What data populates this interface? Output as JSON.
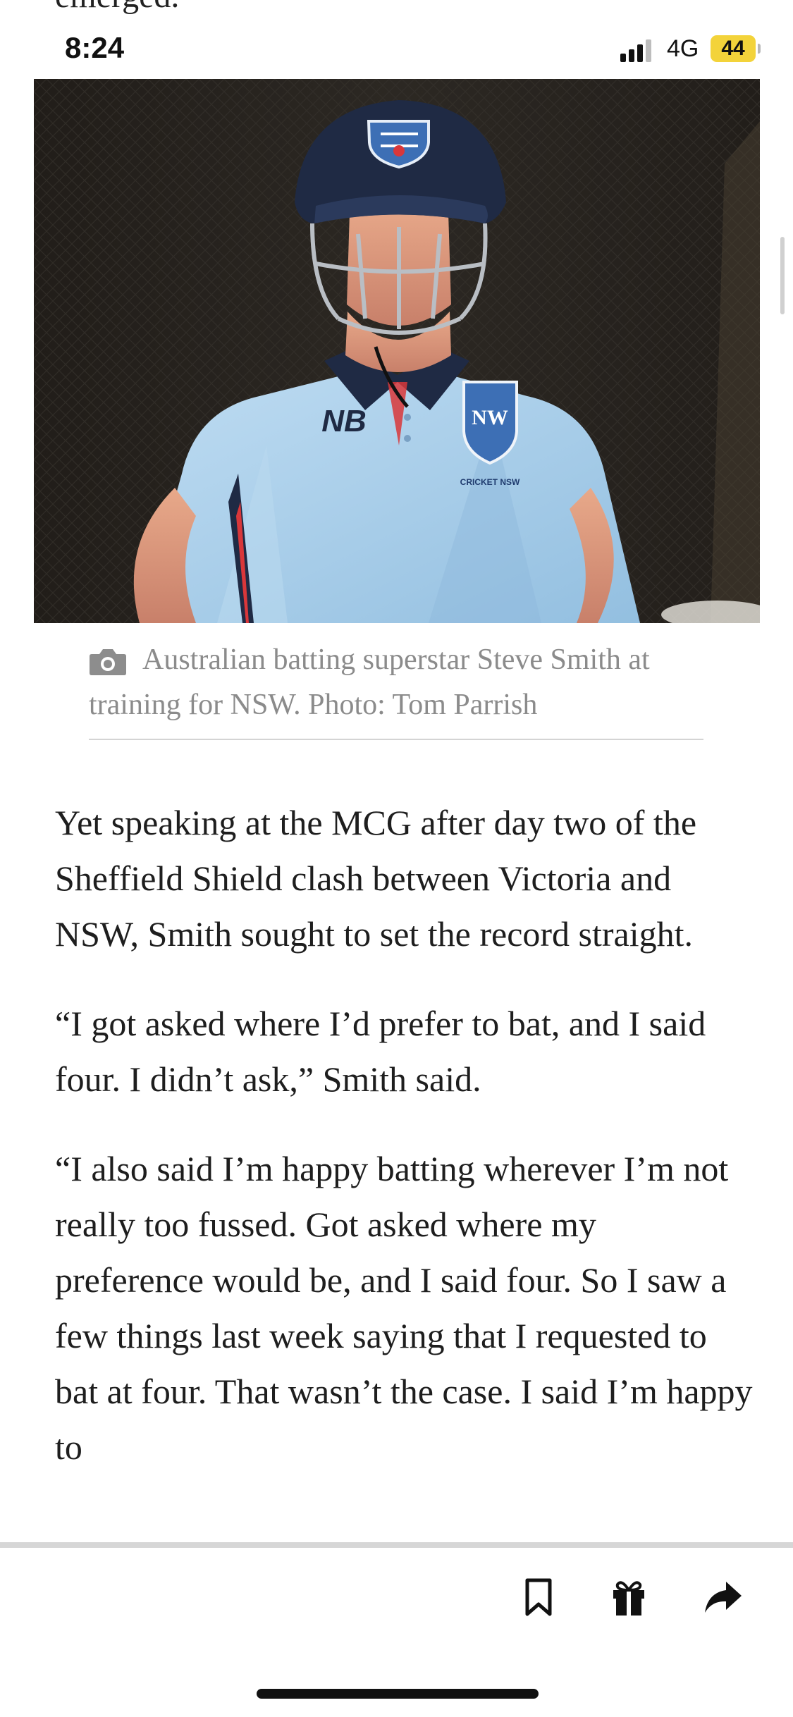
{
  "article": {
    "top_fragment": "emerged.",
    "paragraphs": [
      "Yet speaking at the MCG after day two of the Sheffield Shield clash between Victoria and NSW, Smith sought to set the record straight.",
      "“I got asked where I’d prefer to bat, and I said four. I didn’t ask,” Smith said.",
      "“I also said I’m happy batting wherever I’m not really too fussed. Got asked where my preference would be, and I said four. So I saw a few things last week saying that I requested to bat at four. That wasn’t the case. I said I’m happy to"
    ]
  },
  "status_bar": {
    "time": "8:24",
    "network": "4G",
    "battery": "44"
  },
  "photo": {
    "caption": "Australian batting superstar Steve Smith at training for NSW. Photo: Tom Parrish",
    "caption_icon": "camera-icon",
    "shirt_text": "CRICKET NSW"
  },
  "toolbar": {
    "icons": [
      "bookmark-icon",
      "gift-icon",
      "share-icon"
    ]
  },
  "colors": {
    "background": "#ffffff",
    "body_text": "#1e1e1e",
    "caption_text": "#8b8b8b",
    "battery_fill": "#f3d33a",
    "shirt_blue": "#a9cde9",
    "helmet_navy": "#1f2a44"
  }
}
